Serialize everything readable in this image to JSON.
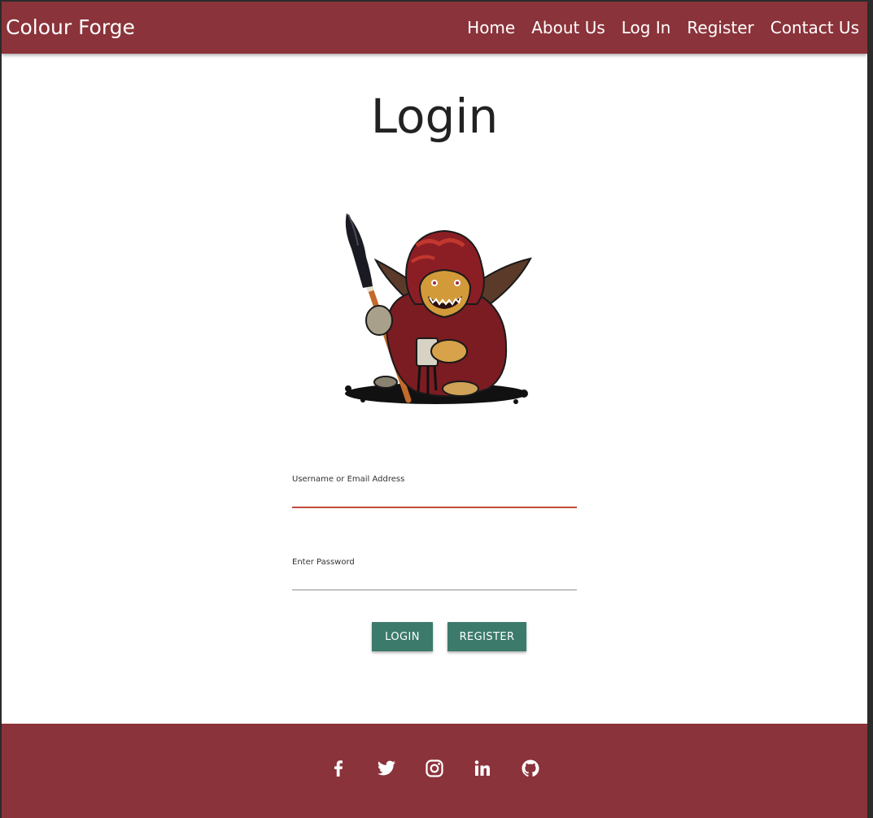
{
  "navbar": {
    "brand": "Colour Forge",
    "links": [
      "Home",
      "About Us",
      "Log In",
      "Register",
      "Contact Us"
    ],
    "color": "#8b333a"
  },
  "main": {
    "title": "Login",
    "image": "goblin-painter-logo",
    "form": {
      "username_label": "Username or Email Address",
      "username_value": "",
      "password_label": "Enter Password",
      "password_value": "",
      "login_button": "LOGIN",
      "register_button": "REGISTER",
      "button_color": "#3c7a6c",
      "active_underline_color": "#c24b3f"
    }
  },
  "footer": {
    "social_icons": [
      "facebook-icon",
      "twitter-icon",
      "instagram-icon",
      "linkedin-icon",
      "github-icon"
    ],
    "color": "#8b333a"
  }
}
